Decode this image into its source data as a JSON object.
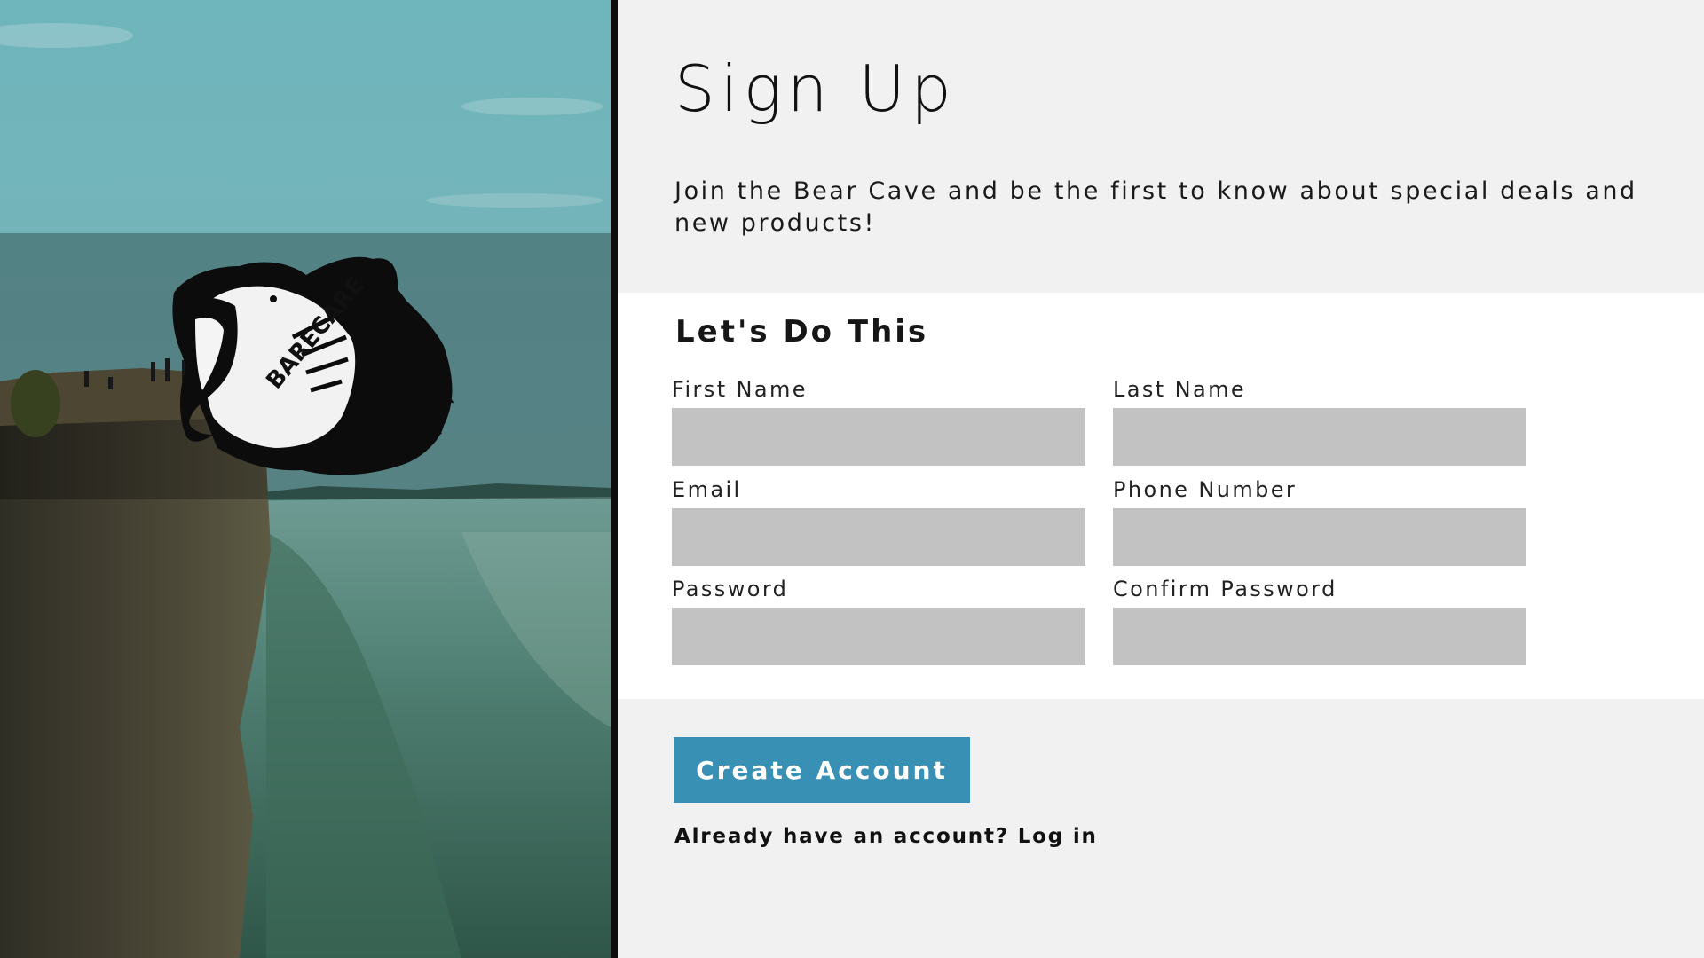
{
  "hero": {
    "logo_text": "BARECARE"
  },
  "signup": {
    "title": "Sign Up",
    "intro": "Join the Bear Cave and be the first to know about special deals and new products!",
    "form_heading": "Let's Do This",
    "fields": {
      "first_name": {
        "label": "First Name",
        "value": ""
      },
      "last_name": {
        "label": "Last Name",
        "value": ""
      },
      "email": {
        "label": "Email",
        "value": ""
      },
      "phone": {
        "label": "Phone Number",
        "value": ""
      },
      "password": {
        "label": "Password",
        "value": ""
      },
      "confirm_password": {
        "label": "Confirm Password",
        "value": ""
      }
    },
    "create_button": "Create Account",
    "login_prompt": "Already have an account?",
    "login_link": "Log in"
  },
  "colors": {
    "accent": "#3890b5",
    "panel_bg": "#f1f1f1",
    "card_bg": "#ffffff",
    "input_bg": "#c2c2c2"
  }
}
